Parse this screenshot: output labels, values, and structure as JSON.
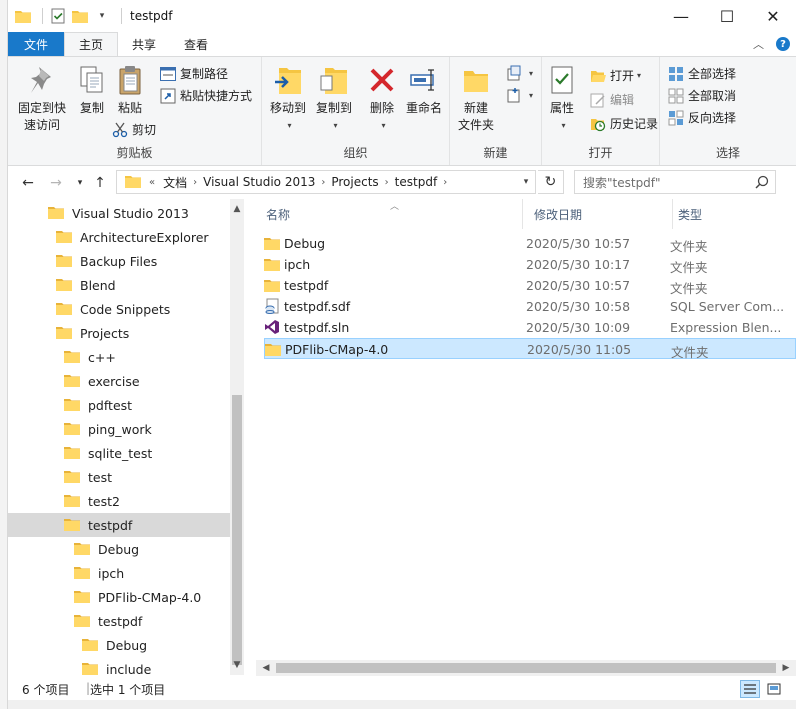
{
  "window": {
    "title": "testpdf",
    "controls": {
      "minimize": "—",
      "maximize": "☐",
      "close": "✕"
    }
  },
  "ribbon_tabs": {
    "file": "文件",
    "home": "主页",
    "share": "共享",
    "view": "查看"
  },
  "ribbon": {
    "clipboard": {
      "label": "剪贴板",
      "pin": "固定到快速访问",
      "pin_line1": "固定到快",
      "pin_line2": "速访问",
      "copy": "复制",
      "paste": "粘贴",
      "copy_path": "复制路径",
      "paste_shortcut": "粘贴快捷方式",
      "cut": "剪切"
    },
    "organize": {
      "label": "组织",
      "move_to": "移动到",
      "copy_to": "复制到",
      "delete": "删除",
      "rename": "重命名"
    },
    "new": {
      "label": "新建",
      "new_folder_line1": "新建",
      "new_folder_line2": "文件夹"
    },
    "open": {
      "label": "打开",
      "properties": "属性",
      "open": "打开",
      "edit": "编辑",
      "history": "历史记录"
    },
    "select": {
      "label": "选择",
      "select_all": "全部选择",
      "select_none": "全部取消",
      "invert": "反向选择"
    }
  },
  "address": {
    "overflow": "«",
    "crumbs": [
      "文档",
      "Visual Studio 2013",
      "Projects",
      "testpdf"
    ]
  },
  "search": {
    "placeholder": "搜索\"testpdf\""
  },
  "nav_tree": [
    {
      "label": "Visual Studio 2013",
      "level": 0
    },
    {
      "label": "ArchitectureExplorer",
      "level": 1
    },
    {
      "label": "Backup Files",
      "level": 1
    },
    {
      "label": "Blend",
      "level": 1
    },
    {
      "label": "Code Snippets",
      "level": 1
    },
    {
      "label": "Projects",
      "level": 1
    },
    {
      "label": "c++",
      "level": 2
    },
    {
      "label": "exercise",
      "level": 2
    },
    {
      "label": "pdftest",
      "level": 2
    },
    {
      "label": "ping_work",
      "level": 2
    },
    {
      "label": "sqlite_test",
      "level": 2
    },
    {
      "label": "test",
      "level": 2
    },
    {
      "label": "test2",
      "level": 2
    },
    {
      "label": "testpdf",
      "level": 2,
      "selected": true
    },
    {
      "label": "Debug",
      "level": 3
    },
    {
      "label": "ipch",
      "level": 3
    },
    {
      "label": "PDFlib-CMap-4.0",
      "level": 3
    },
    {
      "label": "testpdf",
      "level": 3
    },
    {
      "label": "Debug",
      "level": 4
    },
    {
      "label": "include",
      "level": 4
    }
  ],
  "columns": {
    "name": "名称",
    "date": "修改日期",
    "type": "类型"
  },
  "files": [
    {
      "name": "Debug",
      "date": "2020/5/30 10:57",
      "type": "文件夹",
      "icon": "folder"
    },
    {
      "name": "ipch",
      "date": "2020/5/30 10:17",
      "type": "文件夹",
      "icon": "folder"
    },
    {
      "name": "testpdf",
      "date": "2020/5/30 10:57",
      "type": "文件夹",
      "icon": "folder"
    },
    {
      "name": "testpdf.sdf",
      "date": "2020/5/30 10:58",
      "type": "SQL Server Com...",
      "icon": "sdf"
    },
    {
      "name": "testpdf.sln",
      "date": "2020/5/30 10:09",
      "type": "Expression Blen...",
      "icon": "sln"
    },
    {
      "name": "PDFlib-CMap-4.0",
      "date": "2020/5/30 11:05",
      "type": "文件夹",
      "icon": "folder",
      "selected": true
    }
  ],
  "status": {
    "count": "6 个项目",
    "selected": "选中 1 个项目"
  },
  "colors": {
    "accent": "#1979ca",
    "selection": "#cce8ff",
    "folder": "#f5c542"
  }
}
